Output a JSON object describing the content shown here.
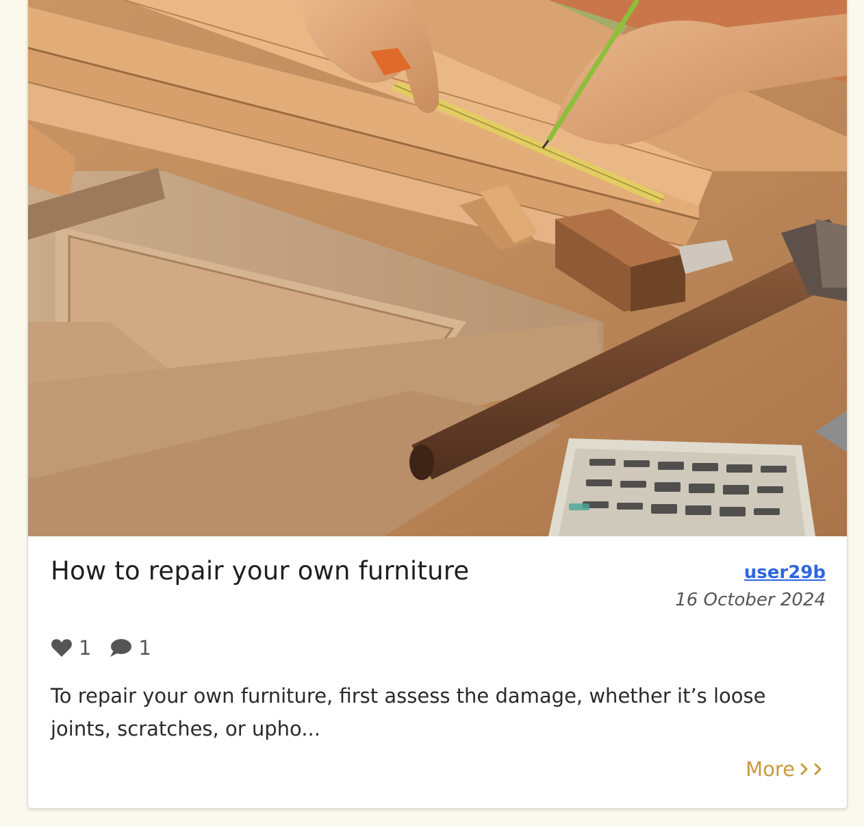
{
  "post": {
    "image_alt": "Carpenter measuring wooden boards with a tape and pencil",
    "title": "How to repair your own furniture",
    "author": "user29b",
    "date": "16 October 2024",
    "likes": "1",
    "comments": "1",
    "excerpt": "To repair your own furniture, first assess the damage, whether it’s loose joints, scratches, or upho...",
    "more_label": "More"
  },
  "icons": {
    "likes": "heart-icon",
    "comments": "speech-bubble-icon",
    "more": "chevron-right-icon"
  },
  "colors": {
    "page_background": "#fbf9ee",
    "author_link": "#2f66e0",
    "more_link": "#c99a3a",
    "muted_text": "#555555"
  }
}
